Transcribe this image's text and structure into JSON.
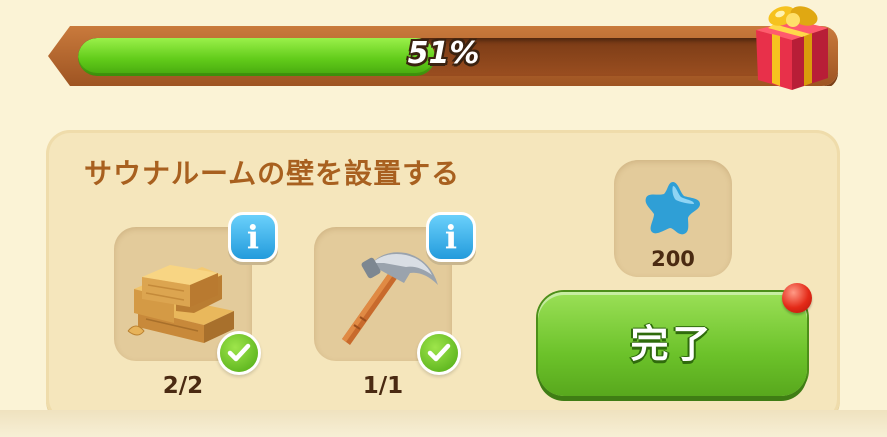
{
  "progress": {
    "value": 0.51,
    "label": "51%"
  },
  "gift": {
    "icon": "gift-box-icon"
  },
  "task": {
    "title": "サウナルームの壁を設置する",
    "requirements": [
      {
        "icon": "wood-planks-icon",
        "count": "2/2",
        "complete": true,
        "info": "i"
      },
      {
        "icon": "hammer-icon",
        "count": "1/1",
        "complete": true,
        "info": "i"
      }
    ],
    "reward": {
      "icon": "blue-star-icon",
      "amount": "200"
    },
    "complete_button": {
      "label": "完了",
      "has_notification": true
    }
  },
  "colors": {
    "progress_green": "#62cc1a",
    "bar_brown": "#9e5422",
    "title_brown": "#a8601f",
    "panel": "#f5e6bc",
    "button_green": "#6cc22a",
    "info_blue": "#239bdc",
    "notification_red": "#e42a18"
  }
}
